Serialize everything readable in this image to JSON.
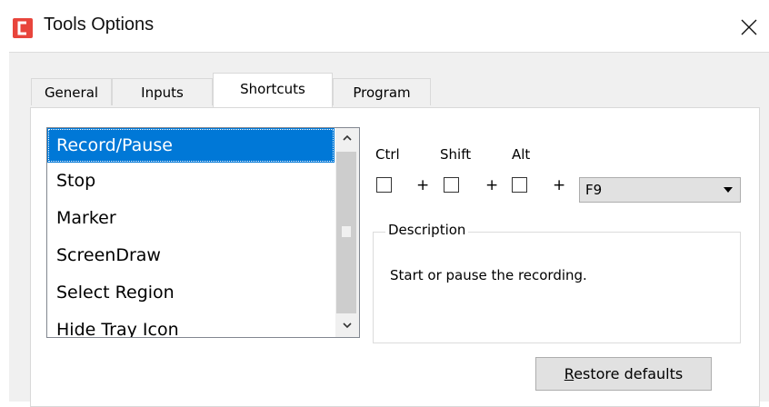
{
  "window": {
    "title": "Tools Options",
    "icon": "camtasia-logo-icon",
    "close_icon": "close-icon"
  },
  "tabs": [
    {
      "label": "General",
      "active": false
    },
    {
      "label": "Inputs",
      "active": false
    },
    {
      "label": "Shortcuts",
      "active": true
    },
    {
      "label": "Program",
      "active": false
    }
  ],
  "shortcuts": {
    "items": [
      {
        "label": "Record/Pause",
        "selected": true
      },
      {
        "label": "Stop",
        "selected": false
      },
      {
        "label": "Marker",
        "selected": false
      },
      {
        "label": "ScreenDraw",
        "selected": false
      },
      {
        "label": "Select Region",
        "selected": false
      },
      {
        "label": "Hide Tray Icon",
        "selected": false
      }
    ],
    "modifiers": {
      "ctrl_label": "Ctrl",
      "shift_label": "Shift",
      "alt_label": "Alt",
      "ctrl_checked": false,
      "shift_checked": false,
      "alt_checked": false,
      "plus": "+"
    },
    "key": {
      "selected_value": "F9"
    },
    "description": {
      "legend": "Description",
      "text": "Start or pause the recording."
    },
    "restore": {
      "accel": "R",
      "rest": "estore defaults"
    }
  },
  "colors": {
    "selection": "#0078d7",
    "app_icon": "#e8453c",
    "dialog_bg": "#f0f0f0",
    "button_bg": "#e1e1e1"
  }
}
